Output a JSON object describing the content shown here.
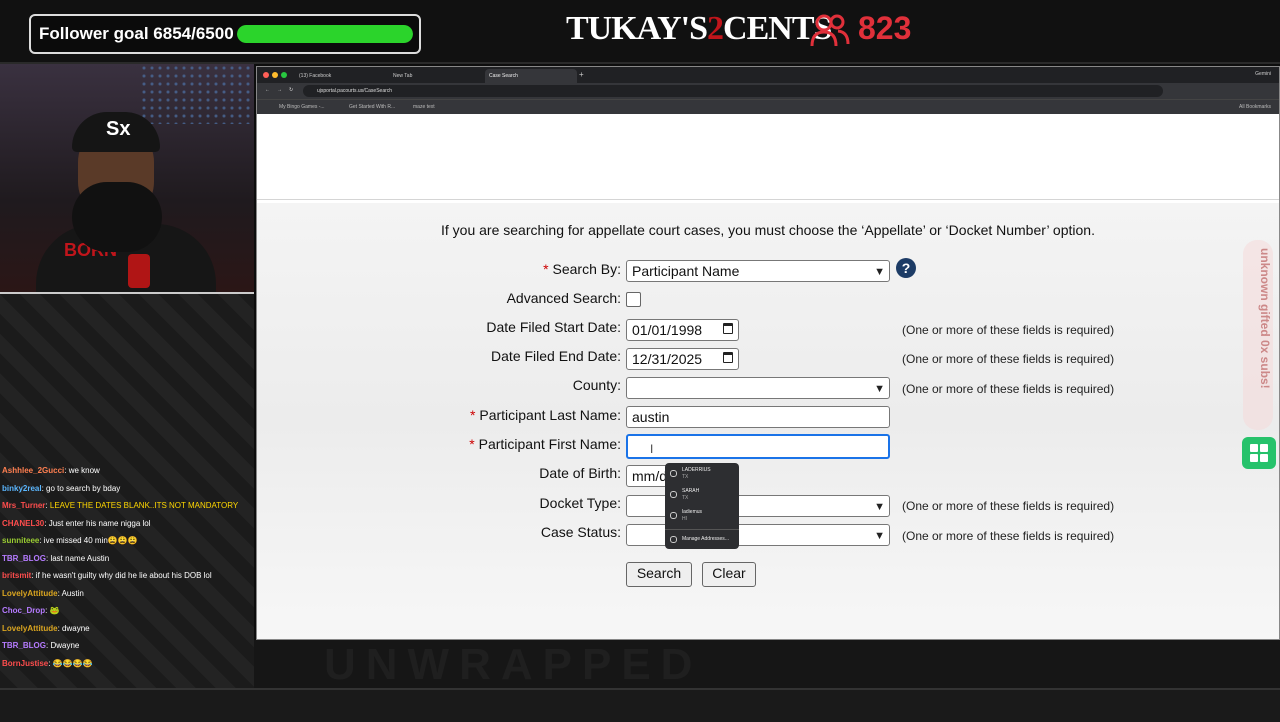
{
  "overlay": {
    "goal_label": "Follower goal 6854/6500",
    "goal_progress": 1.0,
    "logo_left": "TUKAY'S",
    "logo_mid": "2",
    "logo_right": "CENTS",
    "viewer_count": "823",
    "side_text": "unknown gifted 0x subs!",
    "bottom_watermark": "UNWRAPPED"
  },
  "chat": [
    {
      "user": "Ashhlee_2Gucci",
      "color": "#ff7f50",
      "message": "we know"
    },
    {
      "user": "binky2real",
      "color": "#5bb7ff",
      "message": "go to search by bday"
    },
    {
      "user": "Mrs_Turner",
      "color": "#ff4d4d",
      "message": "LEAVE THE DATES BLANK..ITS NOT MANDATORY"
    },
    {
      "user": "CHANEL30",
      "color": "#ff4d4d",
      "message": "Just enter his name nigga lol"
    },
    {
      "user": "sunniteee",
      "color": "#9acd32",
      "message": "ive missed 40 min😩😩😩"
    },
    {
      "user": "TBR_BLOG",
      "color": "#b57bff",
      "message": "last name Austin"
    },
    {
      "user": "britsmit",
      "color": "#ff4d4d",
      "message": "if he wasn't guilty why did he lie about his DOB lol"
    },
    {
      "user": "LovelyAttitude",
      "color": "#daa520",
      "message": "Austin"
    },
    {
      "user": "Choc_Drop",
      "color": "#b57bff",
      "message": "🐸"
    },
    {
      "user": "LovelyAttitude",
      "color": "#daa520",
      "message": "dwayne"
    },
    {
      "user": "TBR_BLOG",
      "color": "#b57bff",
      "message": "Dwayne"
    },
    {
      "user": "BornJustise",
      "color": "#ff4d4d",
      "message": "😂😂😂😂"
    }
  ],
  "browser": {
    "tabs": [
      "(13) Facebook",
      "New Tab",
      "Case Search"
    ],
    "active_tab": "Case Search",
    "url": "ujsportal.pacourts.us/CaseSearch",
    "bookmarks": [
      "My Bingo Games -...",
      "Get Started With R...",
      "maze text"
    ],
    "all_bookmarks": "All Bookmarks",
    "profile": "Gemini"
  },
  "form": {
    "notice": "If you are searching for appellate court cases, you must choose the ‘Appellate’ or ‘Docket Number’ option.",
    "required_mark": "*",
    "search_by_label": "Search By:",
    "search_by_value": "Participant Name",
    "help_icon": "?",
    "advanced_label": "Advanced Search:",
    "start_date_label": "Date Filed Start Date:",
    "start_date_value": "01/01/1998",
    "end_date_label": "Date Filed End Date:",
    "end_date_value": "12/31/2025",
    "county_label": "County:",
    "county_value": "",
    "last_name_label": "Participant Last Name:",
    "last_name_value": "austin",
    "first_name_label": "Participant First Name:",
    "first_name_value": "",
    "dob_label": "Date of Birth:",
    "dob_value": "mm/d",
    "docket_type_label": "Docket Type:",
    "case_status_label": "Case Status:",
    "required_note": "(One or more of these fields is required)",
    "search_button": "Search",
    "clear_button": "Clear"
  },
  "autofill": [
    {
      "name": "LADERRIUS",
      "sub": "TX"
    },
    {
      "name": "SARAH",
      "sub": "TX"
    },
    {
      "name": "ladiemus",
      "sub": "HI"
    }
  ],
  "autofill_manage": "Manage Addresses..."
}
